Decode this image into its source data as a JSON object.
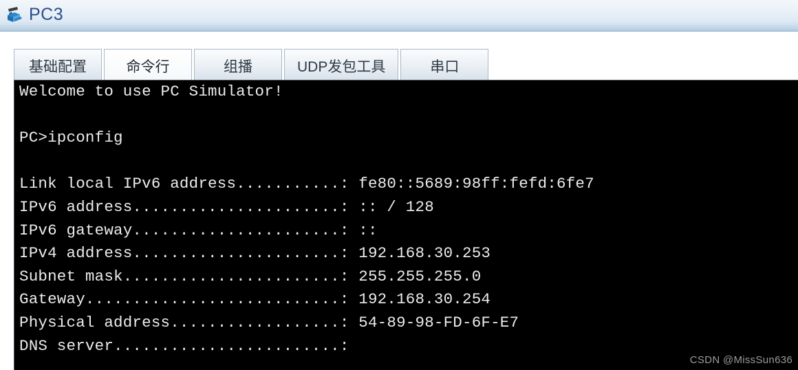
{
  "window": {
    "title": "PC3",
    "icon": "pc-device-icon"
  },
  "tabs": [
    {
      "label": "基础配置",
      "selected": false
    },
    {
      "label": "命令行",
      "selected": true
    },
    {
      "label": "组播",
      "selected": false
    },
    {
      "label": "UDP发包工具",
      "selected": false
    },
    {
      "label": "串口",
      "selected": false
    }
  ],
  "terminal": {
    "background": "#000000",
    "foreground": "#ececec",
    "lines": [
      "Welcome to use PC Simulator!",
      "",
      "PC>ipconfig",
      "",
      "Link local IPv6 address...........: fe80::5689:98ff:fefd:6fe7",
      "IPv6 address......................: :: / 128",
      "IPv6 gateway......................: ::",
      "IPv4 address......................: 192.168.30.253",
      "Subnet mask.......................: 255.255.255.0",
      "Gateway...........................: 192.168.30.254",
      "Physical address..................: 54-89-98-FD-6F-E7",
      "DNS server........................:"
    ],
    "entries": [
      {
        "label": "Link local IPv6 address",
        "value": "fe80::5689:98ff:fefd:6fe7"
      },
      {
        "label": "IPv6 address",
        "value": ":: / 128"
      },
      {
        "label": "IPv6 gateway",
        "value": "::"
      },
      {
        "label": "IPv4 address",
        "value": "192.168.30.253"
      },
      {
        "label": "Subnet mask",
        "value": "255.255.255.0"
      },
      {
        "label": "Gateway",
        "value": "192.168.30.254"
      },
      {
        "label": "Physical address",
        "value": "54-89-98-FD-6F-E7"
      },
      {
        "label": "DNS server",
        "value": ""
      }
    ],
    "command": "ipconfig",
    "prompt": "PC>",
    "banner": "Welcome to use PC Simulator!"
  },
  "watermark": "CSDN @MissSun636"
}
